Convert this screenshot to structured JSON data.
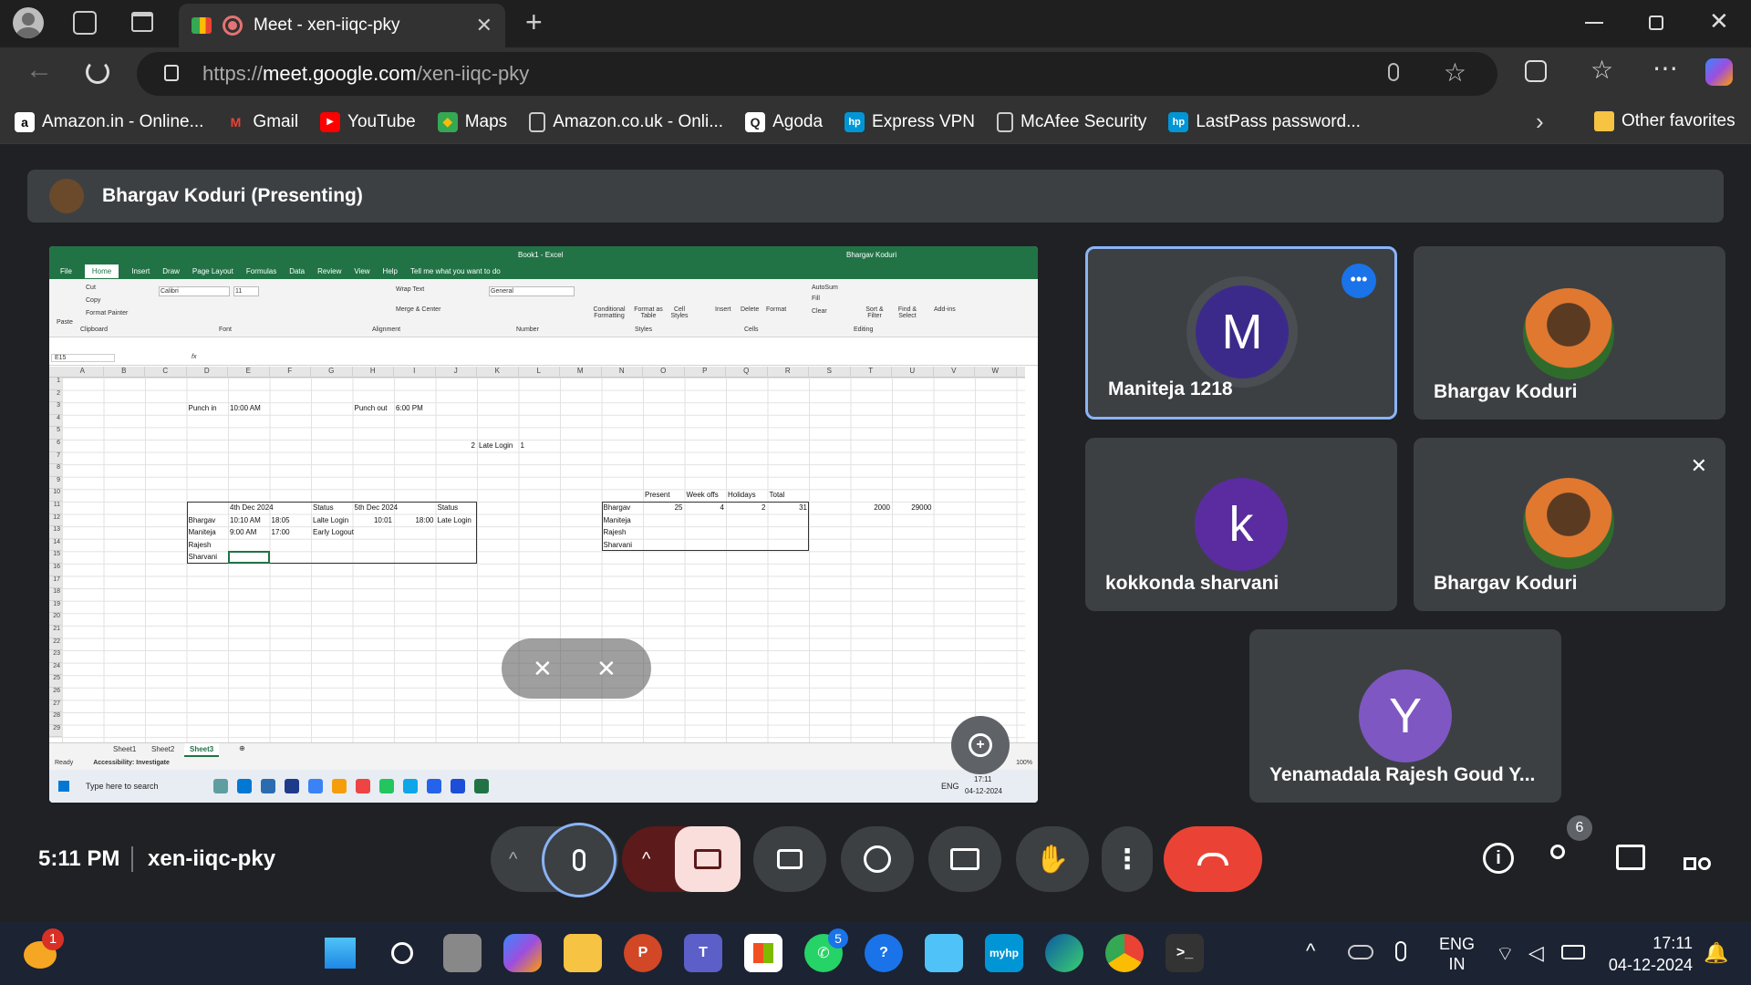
{
  "browser": {
    "tab_title": "Meet - xen-iiqc-pky",
    "url_scheme": "https://",
    "url_host": "meet.google.com",
    "url_path": "/xen-iiqc-pky",
    "bookmarks": [
      {
        "label": "Amazon.in - Online...",
        "icon": "amazon-icon",
        "color": "#ffffff"
      },
      {
        "label": "Gmail",
        "icon": "gmail-icon",
        "color": "#ea4335"
      },
      {
        "label": "YouTube",
        "icon": "youtube-icon",
        "color": "#ff0000"
      },
      {
        "label": "Maps",
        "icon": "maps-icon",
        "color": "#34a853"
      },
      {
        "label": "Amazon.co.uk - Onli...",
        "icon": "page-icon",
        "color": "#cccccc"
      },
      {
        "label": "Agoda",
        "icon": "agoda-icon",
        "color": "#ffffff"
      },
      {
        "label": "Express VPN",
        "icon": "hp-icon",
        "color": "#0096d6"
      },
      {
        "label": "McAfee Security",
        "icon": "page-icon",
        "color": "#cccccc"
      },
      {
        "label": "LastPass password...",
        "icon": "hp-icon",
        "color": "#0096d6"
      }
    ],
    "other_favorites": "Other favorites"
  },
  "meet": {
    "presenting_label": "Bhargav Koduri (Presenting)",
    "time": "5:11 PM",
    "meeting_code": "xen-iiqc-pky",
    "participant_count": "6",
    "tiles": [
      {
        "name": "Maniteja 1218",
        "initial": "M",
        "color": "#3c2a8a",
        "active": true
      },
      {
        "name": "Bhargav Koduri",
        "photo": true
      },
      {
        "name": "kokkonda sharvani",
        "initial": "k",
        "color": "#5b2ca0"
      },
      {
        "name": "Bhargav Koduri",
        "photo": true,
        "muted": true
      },
      {
        "name": "Yenamadala Rajesh Goud Y...",
        "initial": "Y",
        "color": "#7e57c2"
      }
    ]
  },
  "excel": {
    "title": "Book1 - Excel",
    "user": "Bhargav Koduri",
    "tabs": [
      "File",
      "Home",
      "Insert",
      "Draw",
      "Page Layout",
      "Formulas",
      "Data",
      "Review",
      "View",
      "Help",
      "Tell me what you want to do"
    ],
    "ribbon": {
      "cut": "Cut",
      "copy": "Copy",
      "format_painter": "Format Painter",
      "clipboard": "Clipboard",
      "font_name": "Calibri",
      "font_size": "11",
      "font": "Font",
      "wrap": "Wrap Text",
      "merge": "Merge & Center",
      "alignment": "Alignment",
      "number_format": "General",
      "number": "Number",
      "cond": "Conditional Formatting",
      "format_table": "Format as Table",
      "cell_styles": "Cell Styles",
      "styles": "Styles",
      "insert": "Insert",
      "delete": "Delete",
      "format": "Format",
      "cells": "Cells",
      "autosum": "AutoSum",
      "fill": "Fill",
      "clear": "Clear",
      "sort": "Sort & Filter",
      "find": "Find & Select",
      "editing": "Editing",
      "addins": "Add-ins",
      "paste": "Paste"
    },
    "name_box": "E15",
    "columns": [
      "A",
      "B",
      "C",
      "D",
      "E",
      "F",
      "G",
      "H",
      "I",
      "J",
      "K",
      "L",
      "M",
      "N",
      "O",
      "P",
      "Q",
      "R",
      "S",
      "T",
      "U",
      "V",
      "W"
    ],
    "rows": [
      "1",
      "2",
      "3",
      "4",
      "5",
      "6",
      "7",
      "8",
      "9",
      "10",
      "11",
      "12",
      "13",
      "14",
      "15",
      "16",
      "17",
      "18",
      "19",
      "20",
      "21",
      "22",
      "23",
      "24",
      "25",
      "26",
      "27",
      "28",
      "29"
    ],
    "cells": [
      {
        "t": "Punch in",
        "c": 3,
        "r": 3
      },
      {
        "t": "10:00 AM",
        "c": 4,
        "r": 3
      },
      {
        "t": "Punch out",
        "c": 7,
        "r": 3
      },
      {
        "t": "6:00 PM",
        "c": 8,
        "r": 3
      },
      {
        "t": "2",
        "c": 9,
        "r": 6,
        "right": true
      },
      {
        "t": "Late Login",
        "c": 10,
        "r": 6
      },
      {
        "t": "1",
        "c": 11,
        "r": 6
      },
      {
        "t": "Present",
        "c": 14,
        "r": 10
      },
      {
        "t": "Week offs",
        "c": 15,
        "r": 10
      },
      {
        "t": "Holidays",
        "c": 16,
        "r": 10
      },
      {
        "t": "Total",
        "c": 17,
        "r": 10
      },
      {
        "t": "4th Dec 2024",
        "c": 4,
        "r": 11
      },
      {
        "t": "Status",
        "c": 6,
        "r": 11
      },
      {
        "t": "5th Dec 2024",
        "c": 7,
        "r": 11
      },
      {
        "t": "Status",
        "c": 9,
        "r": 11
      },
      {
        "t": "Bhargav",
        "c": 13,
        "r": 11
      },
      {
        "t": "25",
        "c": 14,
        "r": 11,
        "right": true
      },
      {
        "t": "4",
        "c": 15,
        "r": 11,
        "right": true
      },
      {
        "t": "2",
        "c": 16,
        "r": 11,
        "right": true
      },
      {
        "t": "31",
        "c": 17,
        "r": 11,
        "right": true
      },
      {
        "t": "2000",
        "c": 19,
        "r": 11,
        "right": true
      },
      {
        "t": "29000",
        "c": 20,
        "r": 11,
        "right": true
      },
      {
        "t": "Bhargav",
        "c": 3,
        "r": 12
      },
      {
        "t": "10:10 AM",
        "c": 4,
        "r": 12
      },
      {
        "t": "18:05",
        "c": 5,
        "r": 12
      },
      {
        "t": "Lalte Login",
        "c": 6,
        "r": 12
      },
      {
        "t": "10:01",
        "c": 7,
        "r": 12,
        "right": true
      },
      {
        "t": "18:00",
        "c": 8,
        "r": 12,
        "right": true
      },
      {
        "t": "Late Login",
        "c": 9,
        "r": 12
      },
      {
        "t": "Maniteja",
        "c": 13,
        "r": 12
      },
      {
        "t": "Maniteja",
        "c": 3,
        "r": 13
      },
      {
        "t": "9:00 AM",
        "c": 4,
        "r": 13
      },
      {
        "t": "17:00",
        "c": 5,
        "r": 13
      },
      {
        "t": "Early Logout",
        "c": 6,
        "r": 13
      },
      {
        "t": "Rajesh",
        "c": 13,
        "r": 13
      },
      {
        "t": "Rajesh",
        "c": 3,
        "r": 14
      },
      {
        "t": "Sharvani",
        "c": 13,
        "r": 14
      },
      {
        "t": "Sharvani",
        "c": 3,
        "r": 15
      }
    ],
    "sheets": [
      "Sheet1",
      "Sheet2",
      "Sheet3"
    ],
    "active_sheet": "Sheet3",
    "status_ready": "Ready",
    "status_access": "Accessibility: Investigate",
    "zoom": "100%",
    "taskbar_search": "Type here to search",
    "taskbar_lang": "ENG",
    "taskbar_time": "17:11",
    "taskbar_date": "04-12-2024"
  },
  "taskbar": {
    "lang_line1": "ENG",
    "lang_line2": "IN",
    "time": "17:11",
    "date": "04-12-2024",
    "weather_badge": "1",
    "whatsapp_badge": "5"
  }
}
